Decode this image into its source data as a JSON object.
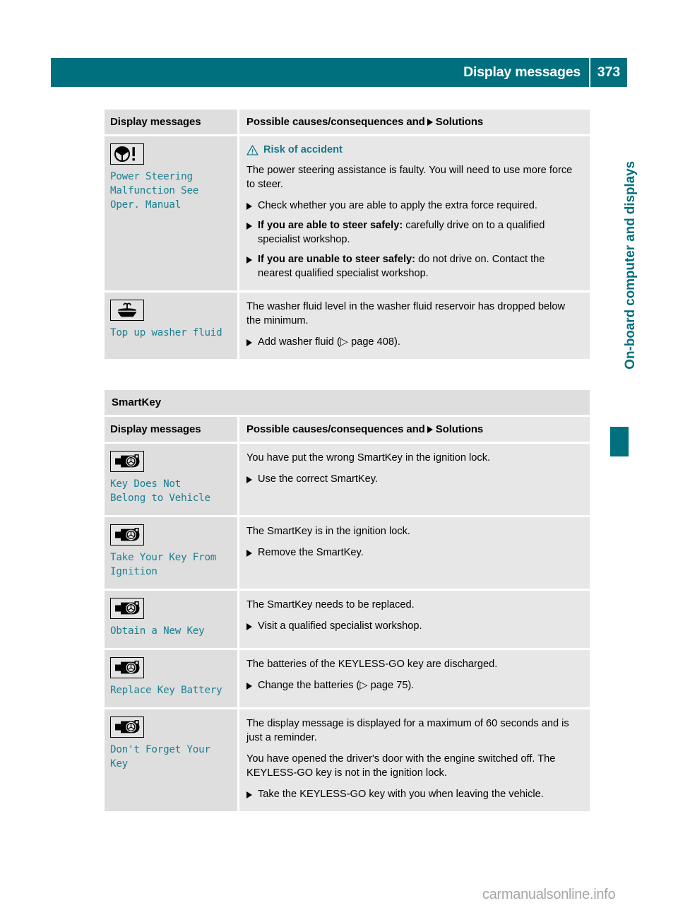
{
  "header": {
    "title": "Display messages",
    "page_number": "373",
    "accent_color": "#00707f"
  },
  "side_tab": {
    "chapter_title": "On-board computer and displays"
  },
  "watermark": {
    "text": "carmanualsonline.info"
  },
  "tables": [
    {
      "id": "table-general",
      "section_band": null,
      "columns": {
        "col1_header": "Display messages",
        "col2_header_pre": "Possible causes/consequences and",
        "col2_header_post": "Solutions"
      },
      "rows": [
        {
          "icon": "steering-wheel-warning-icon",
          "message": "Power Steering\nMalfunction See\nOper. Manual",
          "warning_heading": "Risk of accident",
          "paragraphs": [
            "The power steering assistance is faulty. You will need to use more force to steer."
          ],
          "steps": [
            {
              "bold": "",
              "text": "Check whether you are able to apply the extra force required."
            },
            {
              "bold": "If you are able to steer safely:",
              "text": " carefully drive on to a qualified specialist workshop."
            },
            {
              "bold": "If you are unable to steer safely:",
              "text": " do not drive on. Contact the nearest qualified specialist workshop."
            }
          ]
        },
        {
          "icon": "washer-fluid-icon",
          "message": "Top up washer fluid",
          "warning_heading": null,
          "paragraphs": [
            "The washer fluid level in the washer fluid reservoir has dropped below the minimum."
          ],
          "steps": [
            {
              "bold": "",
              "text": "Add washer fluid (▷ page 408)."
            }
          ]
        }
      ]
    },
    {
      "id": "table-smartkey",
      "section_band": "SmartKey",
      "columns": {
        "col1_header": "Display messages",
        "col2_header_pre": "Possible causes/consequences and",
        "col2_header_post": "Solutions"
      },
      "rows": [
        {
          "icon": "smartkey-icon",
          "message": "Key Does Not\nBelong to Vehicle",
          "warning_heading": null,
          "paragraphs": [
            "You have put the wrong SmartKey in the ignition lock."
          ],
          "steps": [
            {
              "bold": "",
              "text": "Use the correct SmartKey."
            }
          ]
        },
        {
          "icon": "smartkey-icon",
          "message": "Take Your Key From\nIgnition",
          "warning_heading": null,
          "paragraphs": [
            "The SmartKey is in the ignition lock."
          ],
          "steps": [
            {
              "bold": "",
              "text": "Remove the SmartKey."
            }
          ]
        },
        {
          "icon": "smartkey-icon",
          "message": "Obtain a New Key",
          "warning_heading": null,
          "paragraphs": [
            "The SmartKey needs to be replaced."
          ],
          "steps": [
            {
              "bold": "",
              "text": "Visit a qualified specialist workshop."
            }
          ]
        },
        {
          "icon": "smartkey-icon",
          "message": "Replace Key Battery",
          "warning_heading": null,
          "paragraphs": [
            "The batteries of the KEYLESS-GO key are discharged."
          ],
          "steps": [
            {
              "bold": "",
              "text": "Change the batteries (▷ page 75)."
            }
          ]
        },
        {
          "icon": "smartkey-icon",
          "message": "Don't Forget Your\nKey",
          "warning_heading": null,
          "paragraphs": [
            "The display message is displayed for a maximum of 60 seconds and is just a reminder.",
            "You have opened the driver's door with the engine switched off. The KEYLESS-GO key is not in the ignition lock."
          ],
          "steps": [
            {
              "bold": "",
              "text": "Take the KEYLESS-GO key with you when leaving the vehicle."
            }
          ]
        }
      ]
    }
  ]
}
